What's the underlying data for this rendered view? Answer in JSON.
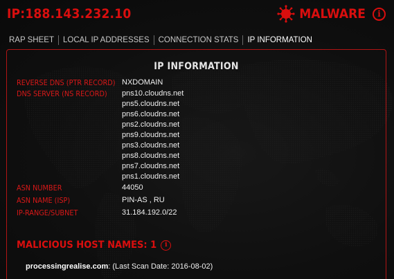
{
  "header": {
    "ip_title": "IP:188.143.232.10",
    "threat_label": "MALWARE",
    "threat_icon": "virus-icon",
    "info_icon": "info-icon"
  },
  "tabs": [
    {
      "label": "RAP SHEET",
      "active": false
    },
    {
      "label": "LOCAL IP ADDRESSES",
      "active": false
    },
    {
      "label": "CONNECTION STATS",
      "active": false
    },
    {
      "label": "IP INFORMATION",
      "active": true
    }
  ],
  "ip_information": {
    "title": "IP INFORMATION",
    "reverse_dns": {
      "label": "REVERSE DNS (PTR RECORD)",
      "value": "NXDOMAIN"
    },
    "dns_server": {
      "label": "DNS SERVER (NS RECORD)",
      "values": [
        "pns10.cloudns.net",
        "pns5.cloudns.net",
        "pns6.cloudns.net",
        "pns2.cloudns.net",
        "pns9.cloudns.net",
        "pns3.cloudns.net",
        "pns8.cloudns.net",
        "pns7.cloudns.net",
        "pns1.cloudns.net"
      ]
    },
    "asn_number": {
      "label": "ASN NUMBER",
      "value": "44050"
    },
    "asn_name": {
      "label": "ASN NAME (ISP)",
      "value": "PIN-AS , RU"
    },
    "ip_range": {
      "label": "IP-RANGE/SUBNET",
      "value": "31.184.192.0/22"
    }
  },
  "malicious_hosts": {
    "title": "MALICIOUS HOST NAMES: 1",
    "hosts": [
      {
        "name": "processingrealise.com",
        "detail": ": (Last Scan Date: 2016-08-02)"
      }
    ]
  },
  "colors": {
    "accent_red": "#d90e0e",
    "label_red": "#d81818",
    "background": "#0d0d0d",
    "text": "#f0f0f0"
  }
}
